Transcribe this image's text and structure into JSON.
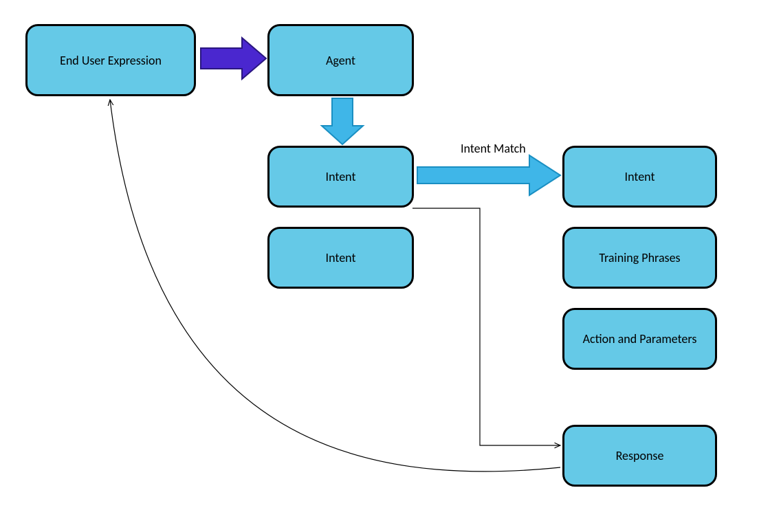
{
  "diagram": {
    "nodes": {
      "end_user_expression": {
        "label": "End User Expression"
      },
      "agent": {
        "label": "Agent"
      },
      "intent_top": {
        "label": "Intent"
      },
      "intent_bottom": {
        "label": "Intent"
      },
      "intent_right": {
        "label": "Intent"
      },
      "training_phrases": {
        "label": "Training Phrases"
      },
      "action_parameters": {
        "label": "Action and Parameters"
      },
      "response": {
        "label": "Response"
      }
    },
    "edges": {
      "intent_match": {
        "label": "Intent Match"
      }
    },
    "colors": {
      "node_fill": "#65c9e7",
      "node_stroke": "#000000",
      "arrow_purple_fill": "#4a27cf",
      "arrow_purple_stroke": "#2a1680",
      "arrow_blue_fill": "#3fb6e8",
      "arrow_blue_stroke": "#1a8fc2",
      "thin_arrow": "#000000"
    }
  }
}
